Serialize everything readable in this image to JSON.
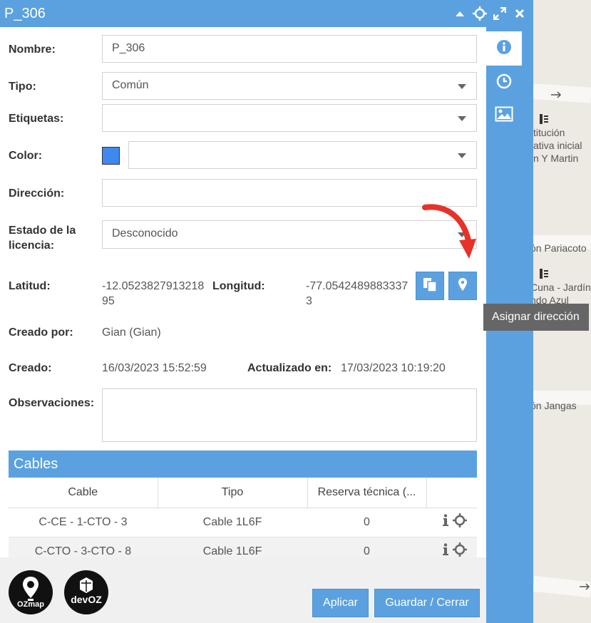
{
  "window": {
    "title": "P_306"
  },
  "form": {
    "nombre": {
      "label": "Nombre:",
      "value": "P_306"
    },
    "tipo": {
      "label": "Tipo:",
      "value": "Común"
    },
    "etiquetas": {
      "label": "Etiquetas:",
      "value": ""
    },
    "color": {
      "label": "Color:",
      "swatch": "#3e88f0",
      "value": ""
    },
    "direccion": {
      "label": "Dirección:",
      "value": ""
    },
    "estado": {
      "label_line1": "Estado de la",
      "label_line2": "licencia:",
      "value": "Desconocido"
    },
    "latitud": {
      "label": "Latitud:",
      "line1": "-12.0523827913218",
      "line2": "95"
    },
    "longitud": {
      "label": "Longitud:",
      "line1": "-77.0542489883337",
      "line2": "3"
    },
    "creado_por": {
      "label": "Creado por:",
      "value": "Gian (Gian)"
    },
    "creado": {
      "label": "Creado:",
      "value": "16/03/2023 15:52:59"
    },
    "actualizado": {
      "label": "Actualizado en:",
      "value": "17/03/2023 10:19:20"
    },
    "observaciones": {
      "label": "Observaciones:",
      "value": ""
    }
  },
  "tooltip": "Asignar dirección",
  "cables": {
    "title": "Cables",
    "columns": [
      "Cable",
      "Tipo",
      "Reserva técnica (..."
    ],
    "rows": [
      {
        "cable": "C-CE - 1-CTO - 3",
        "tipo": "Cable 1L6F",
        "reserva": "0"
      },
      {
        "cable": "C-CTO - 3-CTO - 8",
        "tipo": "Cable 1L6F",
        "reserva": "0"
      }
    ]
  },
  "footer": {
    "aplicar": "Aplicar",
    "guardar": "Guardar / Cerrar"
  },
  "logos": {
    "ozmap": "OZmap",
    "devoz": "devOZ"
  },
  "map_labels": {
    "l1": "titución",
    "l2": "ativa inicial",
    "l3": "n Y Martin",
    "l4": "ón Pariacoto",
    "l5": "Cuna - Jardín",
    "l6": "ndo Azul",
    "l7": "ón Jangas"
  },
  "colors": {
    "accent": "#5ba1e0",
    "tooltip": "#666666",
    "arrow": "#e8312a"
  }
}
